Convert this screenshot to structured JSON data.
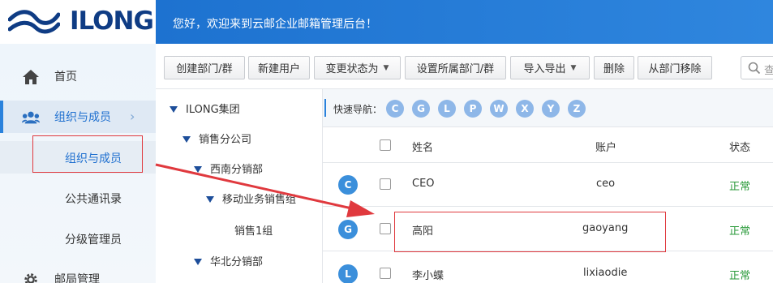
{
  "brand": {
    "logo_text": "ILONG"
  },
  "header": {
    "welcome": "您好，欢迎来到云邮企业邮箱管理后台！"
  },
  "sidebar": {
    "home": "首页",
    "org": "组织与成员",
    "sub_org": "组织与成员",
    "sub_contacts": "公共通讯录",
    "sub_admins": "分级管理员",
    "mail_mgmt": "邮局管理"
  },
  "toolbar": {
    "create_dept": "创建部门/群",
    "new_user": "新建用户",
    "change_status": "变更状态为",
    "set_dept": "设置所属部门/群",
    "import_export": "导入导出",
    "delete": "删除",
    "remove_from_dept": "从部门移除",
    "search_placeholder": "查"
  },
  "tree": {
    "root": "ILONG集团",
    "sales": "销售分公司",
    "southwest": "西南分销部",
    "mobile": "移动业务销售组",
    "sales1": "销售1组",
    "north": "华北分销部"
  },
  "quick_nav": {
    "label": "快速导航：",
    "letters": [
      "C",
      "G",
      "L",
      "P",
      "W",
      "X",
      "Y",
      "Z"
    ]
  },
  "table": {
    "headers": {
      "name": "姓名",
      "account": "账户",
      "status": "状态"
    },
    "rows": [
      {
        "letter": "C",
        "name": "CEO",
        "account": "ceo",
        "status": "正常"
      },
      {
        "letter": "G",
        "name": "高阳",
        "account": "gaoyang",
        "status": "正常"
      },
      {
        "letter": "L",
        "name": "李小蝶",
        "account": "lixiaodie",
        "status": "正常"
      }
    ]
  },
  "colors": {
    "header_blue": "#1d72d0",
    "accent": "#2a82dc",
    "status_green": "#2a9a3a",
    "annotation_red": "#e0393e"
  }
}
